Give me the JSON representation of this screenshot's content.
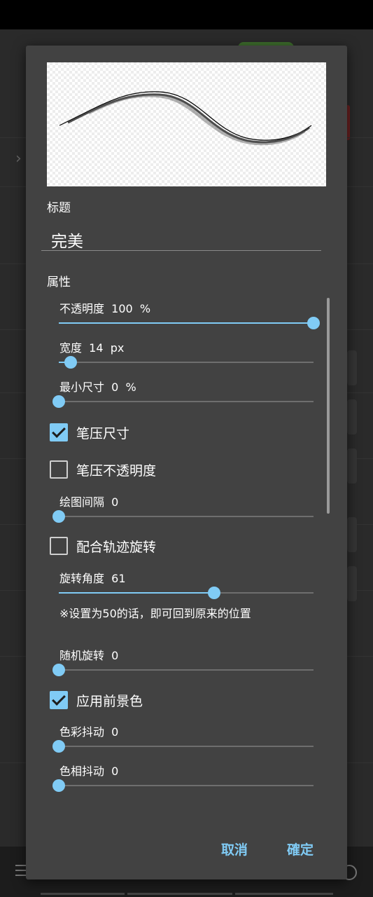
{
  "dialog": {
    "title_label": "标题",
    "title_value": "完美",
    "properties_label": "属性",
    "sliders": {
      "opacity": {
        "label": "不透明度  100  %",
        "value": 1.0
      },
      "width": {
        "label": "宽度  14  px",
        "value": 0.047
      },
      "min_size": {
        "label": "最小尺寸  0  %",
        "value": 0
      },
      "spacing": {
        "label": "绘图间隔  0",
        "value": 0
      },
      "rotation_angle": {
        "label": "旋转角度  61",
        "value": 0.61
      },
      "random_rotation": {
        "label": "随机旋转  0",
        "value": 0
      },
      "color_jitter": {
        "label": "色彩抖动  0",
        "value": 0
      },
      "hue_jitter": {
        "label": "色相抖动  0",
        "value": 0
      }
    },
    "checks": {
      "pressure_size": {
        "label": "笔压尺寸",
        "checked": true
      },
      "pressure_opacity": {
        "label": "笔压不透明度",
        "checked": false
      },
      "follow_path": {
        "label": "配合轨迹旋转",
        "checked": false
      },
      "foreground_color": {
        "label": "应用前景色",
        "checked": true
      }
    },
    "rotation_note": "※设置为50的话，即可回到原来的位置",
    "cancel_label": "取消",
    "ok_label": "確定"
  },
  "colors": {
    "accent": "#80cbf5",
    "dialog_bg": "#424242"
  }
}
